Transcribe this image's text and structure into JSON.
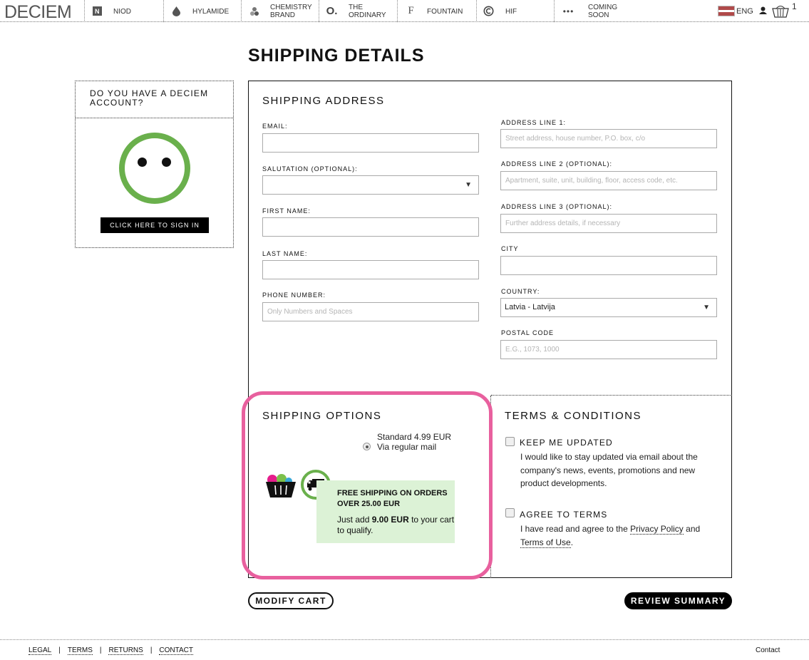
{
  "nav": {
    "logo": "DECIEM",
    "items": [
      {
        "label": "NIOD",
        "icon": "niod-icon"
      },
      {
        "label": "HYLAMIDE",
        "icon": "drop-icon"
      },
      {
        "label": "CHEMISTRY\nBRAND",
        "icon": "chemistry-icon"
      },
      {
        "label": "THE\nORDINARY",
        "icon": "ordinary-icon"
      },
      {
        "label": "FOUNTAIN",
        "icon": "fountain-icon"
      },
      {
        "label": "HIF",
        "icon": "hif-icon"
      },
      {
        "label": "COMING\nSOON",
        "icon": "dots-icon"
      }
    ],
    "language": "ENG",
    "cart_count": "1"
  },
  "page_title": "SHIPPING DETAILS",
  "account": {
    "heading": "DO YOU HAVE A DECIEM ACCOUNT?",
    "signin_label": "CLICK HERE TO SIGN IN"
  },
  "shipping_address": {
    "heading": "SHIPPING ADDRESS",
    "email_label": "EMAIL:",
    "salutation_label": "SALUTATION (OPTIONAL):",
    "salutation_value": "",
    "first_name_label": "FIRST NAME:",
    "last_name_label": "LAST NAME:",
    "phone_label": "PHONE NUMBER:",
    "phone_placeholder": "Only Numbers and Spaces",
    "address1_label": "ADDRESS LINE 1:",
    "address1_placeholder": "Street address, house number, P.O. box, c/o",
    "address2_label": "ADDRESS LINE 2 (OPTIONAL):",
    "address2_placeholder": "Apartment, suite, unit, building, floor, access code, etc.",
    "address3_label": "ADDRESS LINE 3 (OPTIONAL):",
    "address3_placeholder": "Further address details, if necessary",
    "city_label": "CITY",
    "country_label": "COUNTRY:",
    "country_value": "Latvia - Latvija",
    "postal_label": "POSTAL CODE",
    "postal_placeholder": "E.G., 1073, 1000"
  },
  "shipping_options": {
    "heading": "SHIPPING OPTIONS",
    "rate_name": "Standard 4.99 EUR",
    "rate_method": "Via regular mail",
    "promo_title": "FREE SHIPPING ON ORDERS OVER 25.00 EUR",
    "promo_pre": "Just add ",
    "promo_amount": "9.00 EUR",
    "promo_post": " to your cart to qualify."
  },
  "terms": {
    "heading": "TERMS & CONDITIONS",
    "keep_updated_label": "KEEP ME UPDATED",
    "keep_updated_text": "I would like to stay updated via email about the company's news, events, promotions and new product developments.",
    "agree_label": "AGREE TO TERMS",
    "agree_text_pre": "I have read and agree to the ",
    "privacy_link": "Privacy Policy",
    "agree_text_mid": " and ",
    "terms_link": "Terms of Use",
    "agree_text_post": "."
  },
  "buttons": {
    "modify": "MODIFY CART",
    "review": "REVIEW SUMMARY"
  },
  "footer": {
    "links": [
      "LEGAL",
      "TERMS",
      "RETURNS",
      "CONTACT"
    ],
    "contact": "Contact"
  },
  "colors": {
    "accent_green": "#6ab04c",
    "highlight_pink": "#e8609e",
    "promo_bg": "#dcf2d6"
  }
}
